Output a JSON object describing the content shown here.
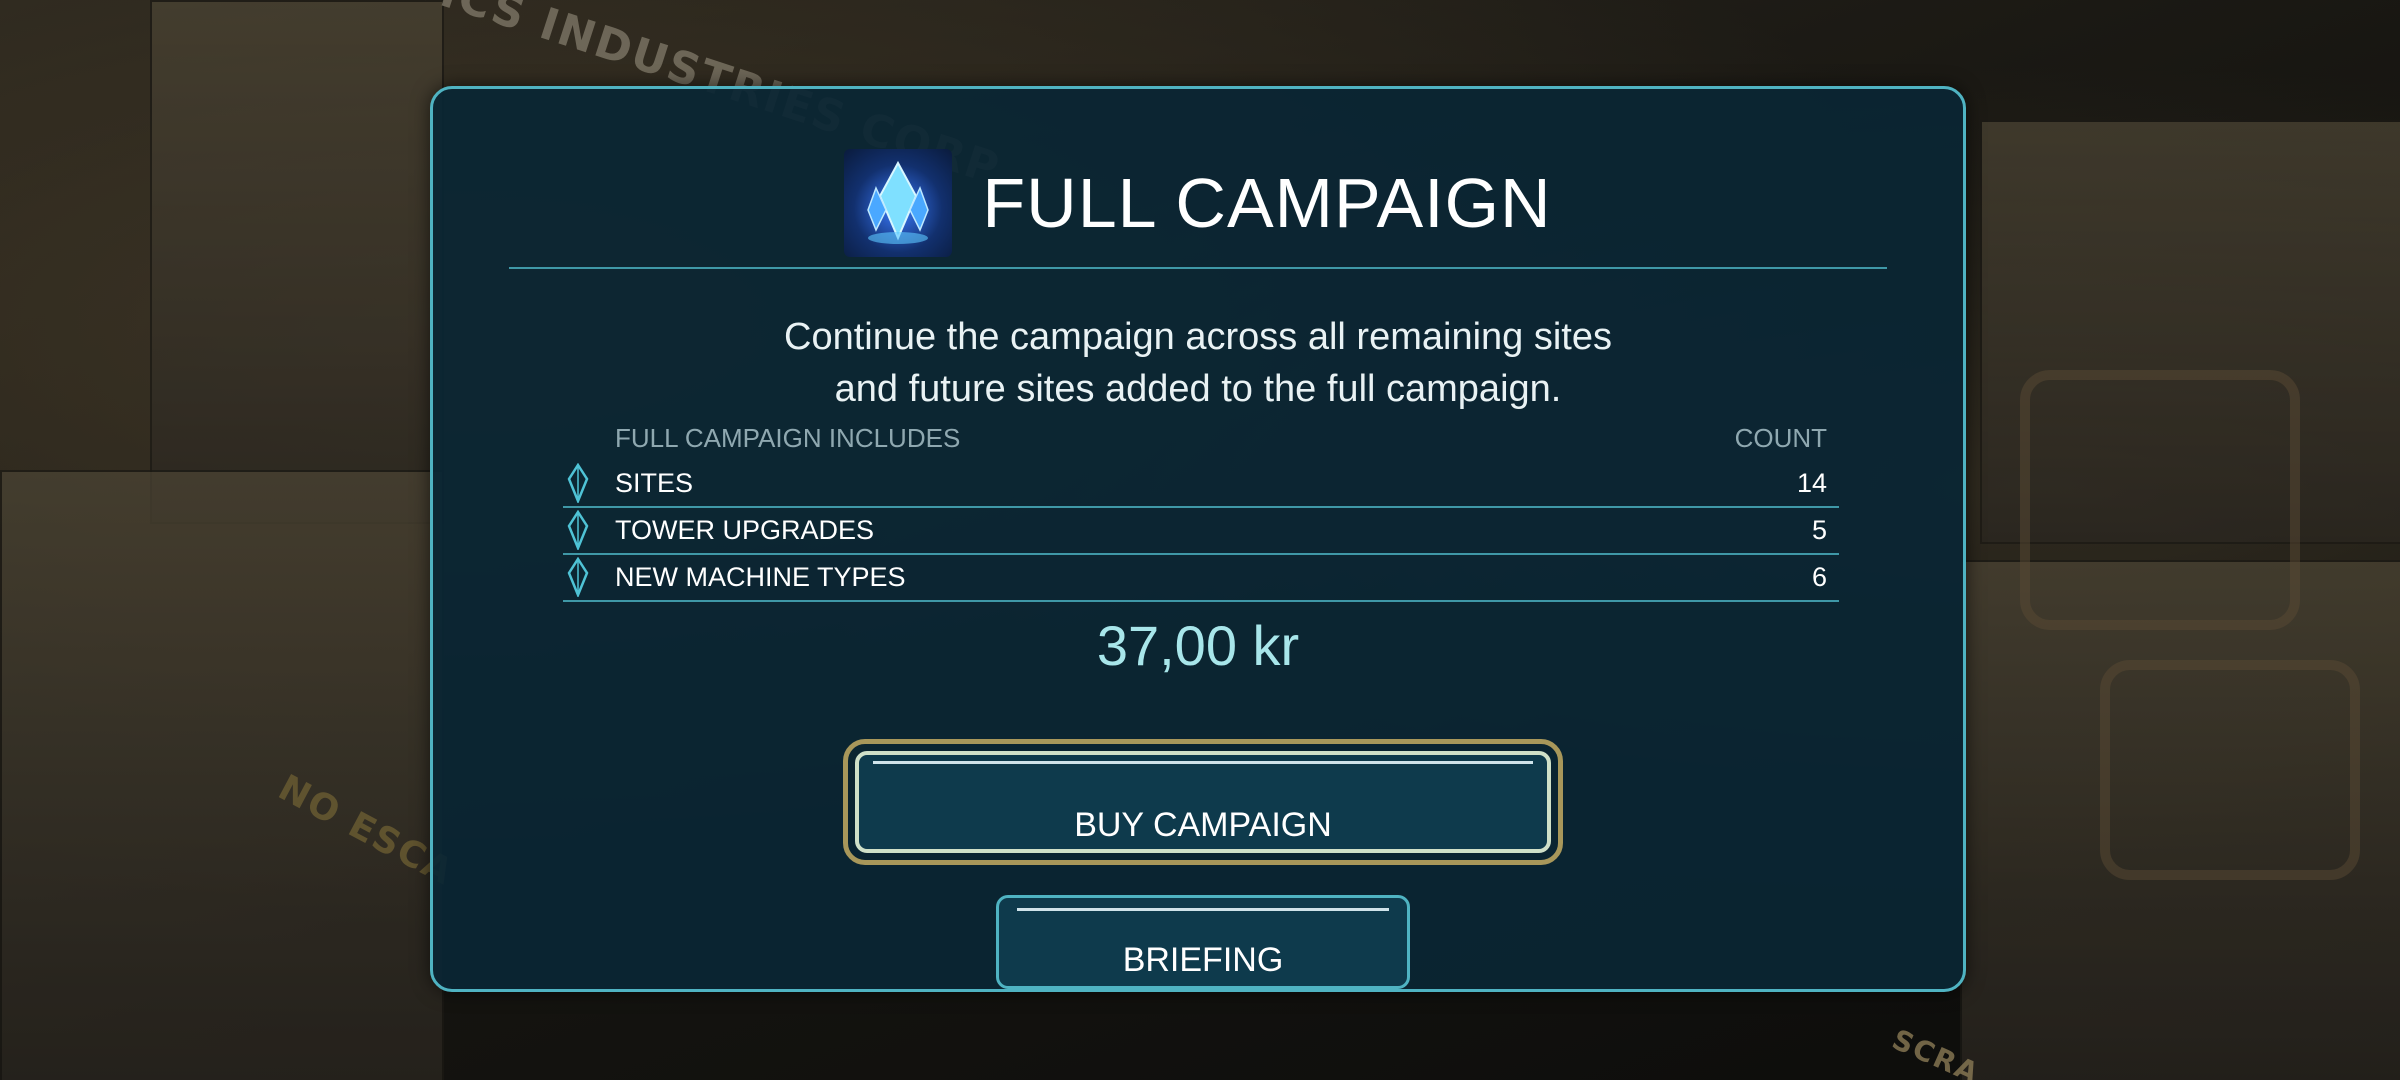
{
  "background": {
    "sign_1": "ROBOTICS INDUSTRIES CORP",
    "sign_2": "NO ESCA",
    "sign_3": "SCRA"
  },
  "dialog": {
    "title": "FULL CAMPAIGN",
    "description_line_1": "Continue the campaign across all remaining sites",
    "description_line_2": "and future sites added to the full campaign.",
    "table": {
      "header_label": "FULL CAMPAIGN INCLUDES",
      "header_count": "COUNT",
      "rows": [
        {
          "label": "SITES",
          "count": "14"
        },
        {
          "label": "TOWER UPGRADES",
          "count": "5"
        },
        {
          "label": "NEW MACHINE TYPES",
          "count": "6"
        }
      ]
    },
    "price": "37,00 kr",
    "buy_button": "BUY CAMPAIGN",
    "briefing_button": "BRIEFING"
  },
  "icons": {
    "header_icon": "crystal-icon",
    "row_icon": "crystal-gem-icon"
  },
  "colors": {
    "panel_border": "#4fb3c2",
    "panel_bg": "#0a2634",
    "price": "#a8e6ea",
    "buy_outline": "#a8975a"
  }
}
